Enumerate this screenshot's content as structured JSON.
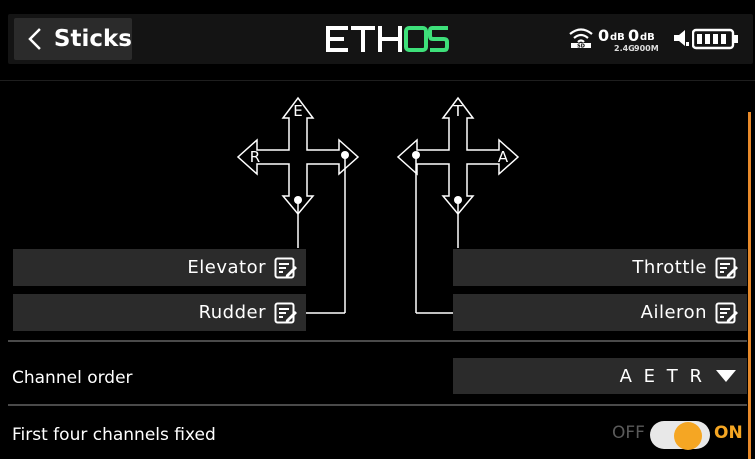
{
  "header": {
    "title": "Sticks",
    "logo_text": "ETHOS",
    "rssi_1_value": "0",
    "rssi_1_unit": "dB",
    "rssi_1_band": "2.4G",
    "rssi_2_value": "0",
    "rssi_2_unit": "dB",
    "rssi_2_band": "900M"
  },
  "diagram": {
    "left_stick": {
      "up": "E",
      "left": "R"
    },
    "right_stick": {
      "up": "T",
      "right": "A"
    }
  },
  "stick_fields": {
    "left_top": "Elevator",
    "left_bottom": "Rudder",
    "right_top": "Throttle",
    "right_bottom": "Aileron"
  },
  "channel_order": {
    "label": "Channel order",
    "value": "A E T R"
  },
  "first_four": {
    "label": "First four channels fixed",
    "off_label": "OFF",
    "on_label": "ON",
    "state": "on"
  },
  "colors": {
    "accent": "#f5a623",
    "background": "#000000",
    "field_bg": "#2b2b2b"
  }
}
